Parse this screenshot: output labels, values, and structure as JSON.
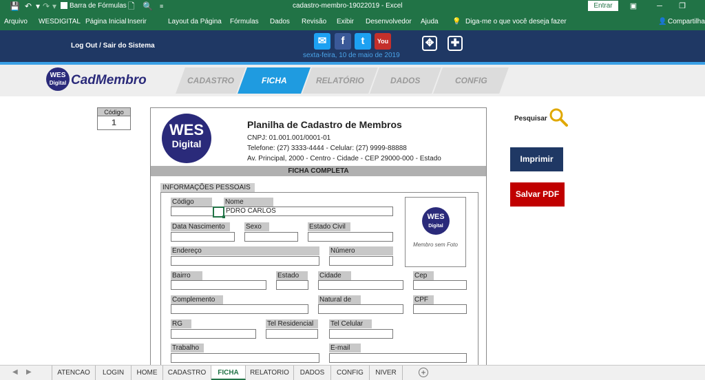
{
  "titlebar": {
    "formula_bar_label": "Barra de Fórmulas",
    "document_title": "cadastro-membro-19022019  -  Excel",
    "signin_label": "Entrar"
  },
  "ribbon": {
    "tabs": [
      "Arquivo",
      "WESDIGITAL",
      "Página Inicial",
      "Inserir",
      "Layout da Página",
      "Fórmulas",
      "Dados",
      "Revisão",
      "Exibir",
      "Desenvolvedor",
      "Ajuda"
    ],
    "tell_me": "Diga-me o que você deseja fazer",
    "share": "Compartilhar"
  },
  "banner": {
    "logout": "Log Out  /  Sair do Sistema",
    "date": "sexta-feira, 10 de maio de 2019",
    "social": [
      "mail-icon",
      "facebook-icon",
      "twitter-icon",
      "youtube-icon"
    ],
    "social_glyphs": [
      "✉",
      "f",
      "t",
      "You"
    ],
    "social_colors": [
      "#1da1f2",
      "#3b5998",
      "#1da1f2",
      "#c4302b"
    ],
    "tools": [
      "✥",
      "✚"
    ]
  },
  "nav": {
    "logo_text": "WES",
    "logo_sub": "Digital",
    "brand": "CadMembro",
    "tabs": [
      "CADASTRO",
      "FICHA",
      "RELATÓRIO",
      "DADOS",
      "CONFIG"
    ],
    "active_tab": "FICHA"
  },
  "codigo": {
    "label": "Código",
    "value": "1"
  },
  "sheet": {
    "logo_text": "WES",
    "logo_sub": "Digital",
    "title": "Planilha de Cadastro de Membros",
    "cnpj": "CNPJ: 01.001.001/0001-01",
    "phones": "Telefone: (27) 3333-4444  - Celular: (27) 9999-88888",
    "address": "Av. Principal, 2000 - Centro - Cidade - CEP 29000-000 - Estado",
    "section": "FICHA COMPLETA",
    "subsection": "INFORMAÇÕES PESSOAIS"
  },
  "fields": {
    "codigo": "Código",
    "nome": "Nome",
    "nome_value": "PDRO CARLOS",
    "data_nascimento": "Data Nascimento",
    "sexo": "Sexo",
    "estado_civil": "Estado Civil",
    "endereco": "Endereço",
    "numero": "Número",
    "bairro": "Bairro",
    "estado": "Estado",
    "cidade": "Cidade",
    "cep": "Cep",
    "complemento": "Complemento",
    "natural_de": "Natural de",
    "cpf": "CPF",
    "rg": "RG",
    "tel_residencial": "Tel Residencial",
    "tel_celular": "Tel Celular",
    "trabalho": "Trabalho",
    "email": "E-mail"
  },
  "photo": {
    "logo_text": "WES",
    "logo_sub": "Digital",
    "caption": "Membro sem Foto"
  },
  "actions": {
    "search": "Pesquisar",
    "print": "Imprimir",
    "pdf": "Salvar PDF"
  },
  "sheettabs": {
    "tabs": [
      "ATENCAO",
      "LOGIN",
      "HOME",
      "CADASTRO",
      "FICHA",
      "RELATORIO",
      "DADOS",
      "CONFIG",
      "NIVER"
    ],
    "active": "FICHA"
  }
}
